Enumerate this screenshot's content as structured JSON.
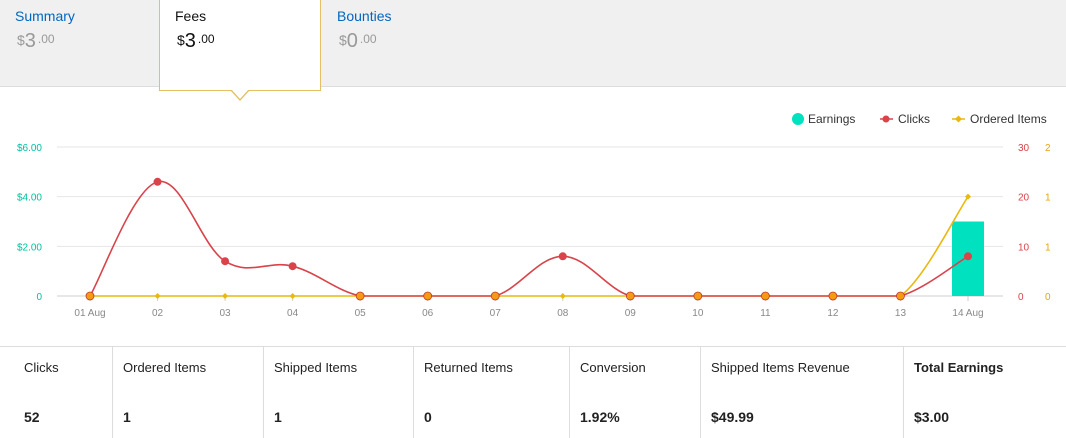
{
  "tabs": [
    {
      "label": "Summary",
      "currency": "$",
      "int": "3",
      "dec": ".00",
      "active": false
    },
    {
      "label": "Fees",
      "currency": "$",
      "int": "3",
      "dec": ".00",
      "active": true
    },
    {
      "label": "Bounties",
      "currency": "$",
      "int": "0",
      "dec": ".00",
      "active": false
    }
  ],
  "legend": [
    {
      "label": "Earnings"
    },
    {
      "label": "Clicks"
    },
    {
      "label": "Ordered Items"
    }
  ],
  "colors": {
    "earnings": "#00e2bf",
    "clicks": "#d9434a",
    "ordered": "#e9b90f",
    "marker_orange": "#f39c12",
    "left_axis": "#00c0a0",
    "right_axis_clicks": "#d9434a",
    "right_axis_items": "#e9a20f"
  },
  "chart_data": {
    "type": "line",
    "categories": [
      "01 Aug",
      "02",
      "03",
      "04",
      "05",
      "06",
      "07",
      "08",
      "09",
      "10",
      "11",
      "12",
      "13",
      "14 Aug"
    ],
    "series": [
      {
        "name": "Earnings",
        "type": "bar",
        "axis": "left",
        "values": [
          0,
          0,
          0,
          0,
          0,
          0,
          0,
          0,
          0,
          0,
          0,
          0,
          0,
          3.0
        ]
      },
      {
        "name": "Clicks",
        "type": "line",
        "axis": "right-clicks",
        "values": [
          0,
          23,
          7,
          6,
          0,
          0,
          0,
          8,
          0,
          0,
          0,
          0,
          0,
          8
        ]
      },
      {
        "name": "Ordered Items",
        "type": "line",
        "axis": "right-items",
        "values": [
          0,
          0,
          0,
          0,
          0,
          0,
          0,
          0,
          0,
          0,
          0,
          0,
          0,
          1
        ]
      }
    ],
    "y_left": {
      "ticks": [
        "0",
        "$2.00",
        "$4.00",
        "$6.00"
      ],
      "range": [
        0,
        6
      ]
    },
    "y_right_clicks": {
      "ticks": [
        "0",
        "10",
        "20",
        "30"
      ],
      "range": [
        0,
        30
      ]
    },
    "y_right_items": {
      "ticks": [
        "0",
        "1",
        "1",
        "2"
      ],
      "range": [
        0,
        1.5
      ]
    },
    "legend_position": "top-right",
    "grid": true
  },
  "metrics": [
    {
      "label": "Clicks",
      "value": "52"
    },
    {
      "label": "Ordered Items",
      "value": "1"
    },
    {
      "label": "Shipped Items",
      "value": "1"
    },
    {
      "label": "Returned Items",
      "value": "0"
    },
    {
      "label": "Conversion",
      "value": "1.92%"
    },
    {
      "label": "Shipped Items Revenue",
      "value": "$49.99"
    },
    {
      "label": "Total Earnings",
      "value": "$3.00"
    }
  ]
}
